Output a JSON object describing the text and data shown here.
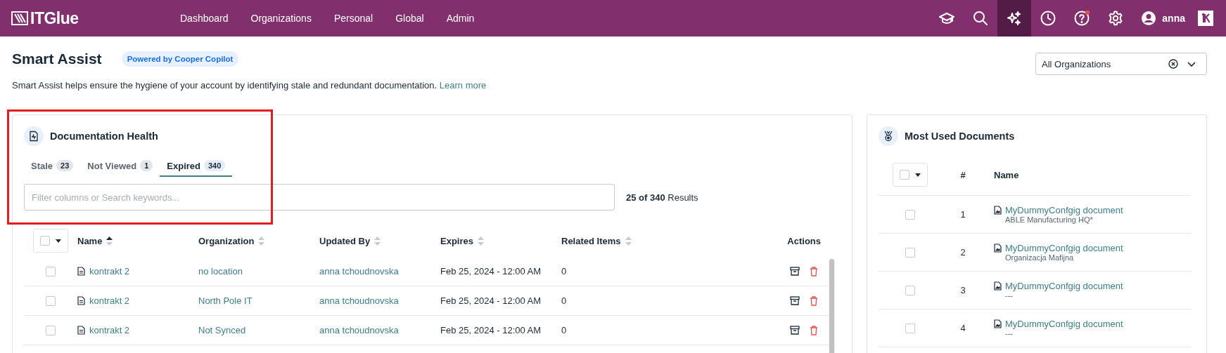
{
  "top_bar": {
    "logo": "ITGlue",
    "nav": [
      {
        "label": "Dashboard"
      },
      {
        "label": "Organizations"
      },
      {
        "label": "Personal"
      },
      {
        "label": "Global"
      },
      {
        "label": "Admin"
      }
    ],
    "tools": [
      {
        "kind": "cap",
        "selected": false,
        "notification": false
      },
      {
        "kind": "search",
        "selected": false,
        "notification": false
      },
      {
        "kind": "sparkle",
        "selected": true,
        "notification": false
      },
      {
        "kind": "clock",
        "selected": false,
        "notification": false
      },
      {
        "kind": "help",
        "selected": false,
        "notification": true
      },
      {
        "kind": "gear",
        "selected": false,
        "notification": false
      }
    ],
    "user": "anna"
  },
  "page": {
    "title": "Smart Assist",
    "badge": "Powered by Cooper Copilot",
    "description": "Smart Assist helps ensure the hygiene of your account by identifying stale and redundant documentation.",
    "link": "Learn more",
    "org_select": {
      "value": "All Organizations"
    }
  },
  "health": {
    "title": "Documentation Health",
    "tabs": [
      {
        "label": "Stale",
        "count": "23",
        "selected": false
      },
      {
        "label": "Not Viewed",
        "count": "1",
        "selected": false
      },
      {
        "label": "Expired",
        "count": "340",
        "selected": true
      }
    ],
    "search": {
      "placeholder": "Filter columns or Search keywords..."
    },
    "results": {
      "count": "25 of 340",
      "label": "Results"
    },
    "columns": [
      {
        "label": "Name",
        "sorted": true
      },
      {
        "label": "Organization",
        "sorted": false
      },
      {
        "label": "Updated By",
        "sorted": false
      },
      {
        "label": "Expires",
        "sorted": false
      },
      {
        "label": "Related Items",
        "sorted": false
      },
      {
        "label": "Actions"
      }
    ],
    "rows": [
      {
        "checked": false,
        "name": "kontrakt 2",
        "organization": "no location",
        "updated_by": "anna tchoudnovska",
        "expires": "Feb 25, 2024 - 12:00 AM",
        "related": "0"
      },
      {
        "checked": false,
        "name": "kontrakt 2",
        "organization": "North Pole IT",
        "updated_by": "anna tchoudnovska",
        "expires": "Feb 25, 2024 - 12:00 AM",
        "related": "0"
      },
      {
        "checked": false,
        "name": "kontrakt 2",
        "organization": "Not Synced",
        "updated_by": "anna tchoudnovska",
        "expires": "Feb 25, 2024 - 12:00 AM",
        "related": "0"
      }
    ]
  },
  "most_used": {
    "title": "Most Used Documents",
    "columns": [
      "#",
      "Name"
    ],
    "rows": [
      {
        "checked": false,
        "number": "1",
        "name": "MyDummyConfgig document",
        "organization": "ABLE Manufacturing HQ*"
      },
      {
        "checked": false,
        "number": "2",
        "name": "MyDummyConfgig document",
        "organization": "Organizacja Mafijna"
      },
      {
        "checked": false,
        "number": "3",
        "name": "MyDummyConfgig document",
        "organization": "---"
      },
      {
        "checked": false,
        "number": "4",
        "name": "MyDummyConfgig document",
        "organization": "---"
      }
    ]
  }
}
